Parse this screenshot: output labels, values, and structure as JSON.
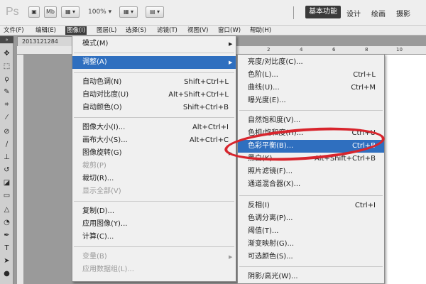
{
  "app": {
    "logo": "Ps",
    "toolbar_icons": [
      "bridge-icon",
      "minibridge-icon",
      "view-extras-icon",
      "arrange-icon",
      "screen-mode-icon"
    ],
    "toolbar_labels": {
      "mb": "Mb",
      "zoom": "100%"
    },
    "workspaces": {
      "active": "基本功能",
      "items": [
        "设计",
        "绘画",
        "摄影"
      ]
    }
  },
  "menubar": {
    "items": [
      "文件(F)",
      "编辑(E)",
      "图像(I)",
      "图层(L)",
      "选择(S)",
      "滤镜(T)",
      "视图(V)",
      "窗口(W)",
      "帮助(H)"
    ],
    "active": "图像(I)"
  },
  "document": {
    "tab_title": "2013121284",
    "ruler_numbers": [
      "2",
      "4",
      "6",
      "8",
      "10"
    ]
  },
  "image_menu": {
    "items": [
      {
        "label": "模式(M)",
        "shortcut": "",
        "submenu": true
      },
      {
        "label": "调整(A)",
        "shortcut": "",
        "submenu": true,
        "highlighted": true
      },
      {
        "label": "自动色调(N)",
        "shortcut": "Shift+Ctrl+L"
      },
      {
        "label": "自动对比度(U)",
        "shortcut": "Alt+Shift+Ctrl+L"
      },
      {
        "label": "自动颜色(O)",
        "shortcut": "Shift+Ctrl+B"
      },
      {
        "label": "图像大小(I)...",
        "shortcut": "Alt+Ctrl+I"
      },
      {
        "label": "画布大小(S)...",
        "shortcut": "Alt+Ctrl+C"
      },
      {
        "label": "图像旋转(G)",
        "shortcut": "",
        "submenu": true
      },
      {
        "label": "裁剪(P)",
        "shortcut": "",
        "disabled": true
      },
      {
        "label": "裁切(R)...",
        "shortcut": ""
      },
      {
        "label": "显示全部(V)",
        "shortcut": "",
        "disabled": true
      },
      {
        "label": "复制(D)...",
        "shortcut": ""
      },
      {
        "label": "应用图像(Y)...",
        "shortcut": ""
      },
      {
        "label": "计算(C)...",
        "shortcut": ""
      },
      {
        "label": "变量(B)",
        "shortcut": "",
        "submenu": true,
        "disabled": true
      },
      {
        "label": "应用数据组(L)...",
        "shortcut": "",
        "disabled": true
      }
    ]
  },
  "adjust_menu": {
    "items": [
      {
        "label": "亮度/对比度(C)...",
        "shortcut": ""
      },
      {
        "label": "色阶(L)...",
        "shortcut": "Ctrl+L"
      },
      {
        "label": "曲线(U)...",
        "shortcut": "Ctrl+M"
      },
      {
        "label": "曝光度(E)...",
        "shortcut": ""
      },
      {
        "label": "自然饱和度(V)...",
        "shortcut": ""
      },
      {
        "label": "色相/饱和度(H)...",
        "shortcut": "Ctrl+U"
      },
      {
        "label": "色彩平衡(B)...",
        "shortcut": "Ctrl+B",
        "highlighted": true
      },
      {
        "label": "黑白(K)...",
        "shortcut": "Alt+Shift+Ctrl+B"
      },
      {
        "label": "照片滤镜(F)...",
        "shortcut": ""
      },
      {
        "label": "通道混合器(X)...",
        "shortcut": ""
      },
      {
        "label": "反相(I)",
        "shortcut": "Ctrl+I"
      },
      {
        "label": "色调分离(P)...",
        "shortcut": ""
      },
      {
        "label": "阈值(T)...",
        "shortcut": ""
      },
      {
        "label": "渐变映射(G)...",
        "shortcut": ""
      },
      {
        "label": "可选颜色(S)...",
        "shortcut": ""
      },
      {
        "label": "阴影/高光(W)...",
        "shortcut": ""
      }
    ]
  },
  "colors": {
    "highlight": "#2f6fbf",
    "annotation_circle": "#d8252d"
  }
}
